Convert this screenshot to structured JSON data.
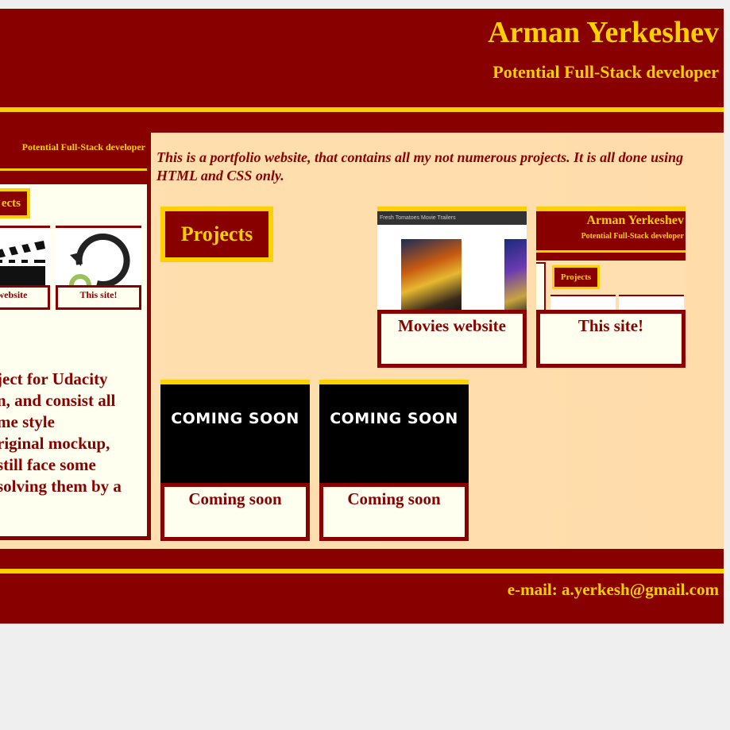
{
  "header": {
    "title": "Arman Yerkeshev",
    "subtitle": "Potential Full-Stack developer"
  },
  "preview": {
    "subtitle": "Potential Full-Stack developer",
    "projects_label": "ects",
    "cards": [
      {
        "caption": "es website"
      },
      {
        "caption": "This site!"
      }
    ],
    "text_lines": [
      "ject for Udacity",
      "n, and consist all",
      "me style",
      "riginal mockup,",
      " still face some",
      "solving them by a"
    ]
  },
  "main": {
    "intro": "This is a portfolio website, that contains all my not numerous projects. It is all done using HTML and CSS only.",
    "projects_label": "Projects",
    "cards": [
      {
        "caption": "Movies website",
        "thumb_bar": "Fresh Tomatoes Movie Trailers"
      },
      {
        "caption": "This site!",
        "thumb_title": "Arman Yerkeshev",
        "thumb_subtitle": "Potential Full-Stack developer",
        "thumb_projects": "Projects"
      },
      {
        "caption": "Coming soon",
        "thumb_text": "COMING SOON"
      },
      {
        "caption": "Coming soon",
        "thumb_text": "COMING SOON"
      }
    ]
  },
  "footer": {
    "email": "e-mail: a.yerkesh@gmail.com"
  },
  "colors": {
    "brand_red": "#880000",
    "accent_gold": "#ffd000",
    "body_bg": "#ffdfb0",
    "card_bg": "#fffff0"
  }
}
